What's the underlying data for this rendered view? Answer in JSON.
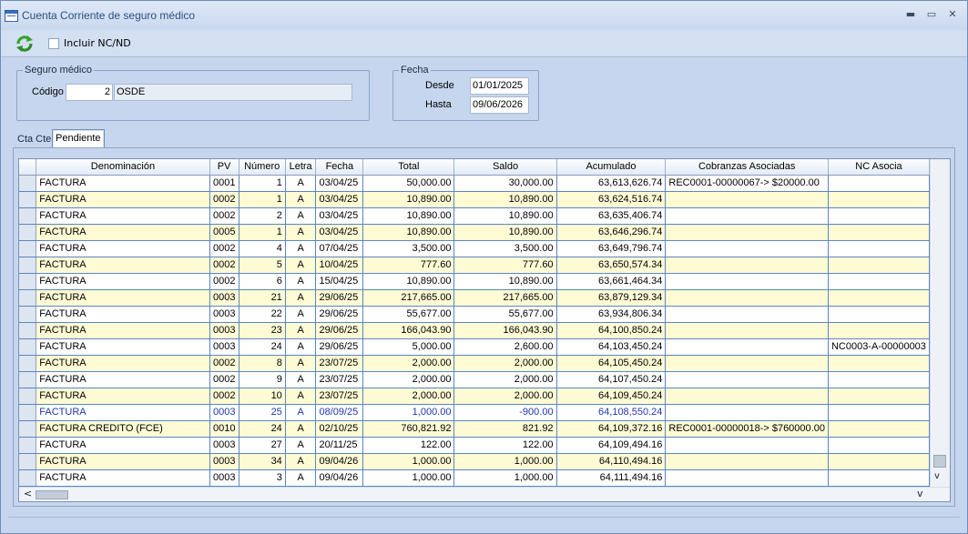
{
  "window": {
    "title": "Cuenta Corriente de seguro médico",
    "minimize": "▬",
    "maximize": "▭",
    "close": "✕"
  },
  "toolbar": {
    "refresh_icon": "refresh-icon",
    "include_label": "Incluir NC/ND",
    "include_checked": false
  },
  "seguro": {
    "legend": "Seguro médico",
    "codigo_label": "Código",
    "codigo_value": "2",
    "nombre_value": "OSDE"
  },
  "fecha": {
    "legend": "Fecha",
    "desde_label": "Desde",
    "desde_value": "01/01/2025",
    "hasta_label": "Hasta",
    "hasta_value": "09/06/2026"
  },
  "tabs": [
    {
      "label": "Cta Cte"
    },
    {
      "label": "Pendiente"
    }
  ],
  "grid": {
    "columns": [
      "",
      "Denominación",
      "PV",
      "Número",
      "Letra",
      "Fecha",
      "Total",
      "Saldo",
      "Acumulado",
      "Cobranzas Asociadas",
      "NC Asocia"
    ],
    "rows": [
      [
        "FACTURA",
        "0001",
        "1",
        "A",
        "03/04/25",
        "50,000.00",
        "30,000.00",
        "63,613,626.74",
        "REC0001-00000067-> $20000.00",
        ""
      ],
      [
        "FACTURA",
        "0002",
        "1",
        "A",
        "03/04/25",
        "10,890.00",
        "10,890.00",
        "63,624,516.74",
        "",
        ""
      ],
      [
        "FACTURA",
        "0002",
        "2",
        "A",
        "03/04/25",
        "10,890.00",
        "10,890.00",
        "63,635,406.74",
        "",
        ""
      ],
      [
        "FACTURA",
        "0005",
        "1",
        "A",
        "03/04/25",
        "10,890.00",
        "10,890.00",
        "63,646,296.74",
        "",
        ""
      ],
      [
        "FACTURA",
        "0002",
        "4",
        "A",
        "07/04/25",
        "3,500.00",
        "3,500.00",
        "63,649,796.74",
        "",
        ""
      ],
      [
        "FACTURA",
        "0002",
        "5",
        "A",
        "10/04/25",
        "777.60",
        "777.60",
        "63,650,574.34",
        "",
        ""
      ],
      [
        "FACTURA",
        "0002",
        "6",
        "A",
        "15/04/25",
        "10,890.00",
        "10,890.00",
        "63,661,464.34",
        "",
        ""
      ],
      [
        "FACTURA",
        "0003",
        "21",
        "A",
        "29/06/25",
        "217,665.00",
        "217,665.00",
        "63,879,129.34",
        "",
        ""
      ],
      [
        "FACTURA",
        "0003",
        "22",
        "A",
        "29/06/25",
        "55,677.00",
        "55,677.00",
        "63,934,806.34",
        "",
        ""
      ],
      [
        "FACTURA",
        "0003",
        "23",
        "A",
        "29/06/25",
        "166,043.90",
        "166,043.90",
        "64,100,850.24",
        "",
        ""
      ],
      [
        "FACTURA",
        "0003",
        "24",
        "A",
        "29/06/25",
        "5,000.00",
        "2,600.00",
        "64,103,450.24",
        "",
        "NC0003-A-00000003"
      ],
      [
        "FACTURA",
        "0002",
        "8",
        "A",
        "23/07/25",
        "2,000.00",
        "2,000.00",
        "64,105,450.24",
        "",
        ""
      ],
      [
        "FACTURA",
        "0002",
        "9",
        "A",
        "23/07/25",
        "2,000.00",
        "2,000.00",
        "64,107,450.24",
        "",
        ""
      ],
      [
        "FACTURA",
        "0002",
        "10",
        "A",
        "23/07/25",
        "2,000.00",
        "2,000.00",
        "64,109,450.24",
        "",
        ""
      ],
      [
        "FACTURA",
        "0003",
        "25",
        "A",
        "08/09/25",
        "1,000.00",
        "-900.00",
        "64,108,550.24",
        "",
        ""
      ],
      [
        "FACTURA CREDITO (FCE)",
        "0010",
        "24",
        "A",
        "02/10/25",
        "760,821.92",
        "821.92",
        "64,109,372.16",
        "REC0001-00000018-> $760000.00",
        ""
      ],
      [
        "FACTURA",
        "0003",
        "27",
        "A",
        "20/11/25",
        "122.00",
        "122.00",
        "64,109,494.16",
        "",
        ""
      ],
      [
        "FACTURA",
        "0003",
        "34",
        "A",
        "09/04/26",
        "1,000.00",
        "1,000.00",
        "64,110,494.16",
        "",
        ""
      ],
      [
        "FACTURA",
        "0003",
        "3",
        "A",
        "09/04/26",
        "1,000.00",
        "1,000.00",
        "64,111,494.16",
        "",
        ""
      ]
    ],
    "highlight_row": 14,
    "colors": {
      "row_odd": "#ffffff",
      "row_even": "#fffbd5",
      "highlight_text": "#1e35b4",
      "grid_line": "#5a86c2"
    }
  },
  "scroll": {
    "left_arrow": "<",
    "right_arrow": "v",
    "down_arrow": "v"
  }
}
